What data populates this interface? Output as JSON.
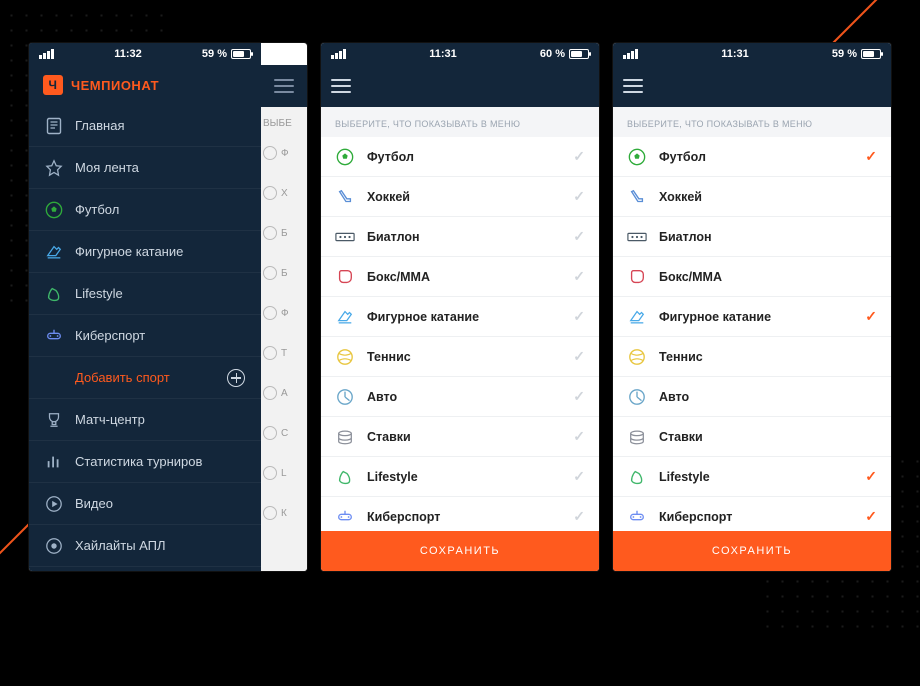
{
  "phones": [
    {
      "status": {
        "time": "11:32",
        "battery_label": "59 %",
        "battery_level": 0.59
      },
      "brand": "ЧЕМПИОНАТ",
      "menu": [
        {
          "icon": "news-icon",
          "label": "Главная"
        },
        {
          "icon": "star-icon",
          "label": "Моя лента"
        },
        {
          "icon": "football-icon",
          "label": "Футбол"
        },
        {
          "icon": "skating-icon",
          "label": "Фигурное катание"
        },
        {
          "icon": "lifestyle-icon",
          "label": "Lifestyle"
        },
        {
          "icon": "esports-icon",
          "label": "Киберспорт"
        },
        {
          "icon": "plus-icon",
          "label": "Добавить спорт",
          "accent": true,
          "plus": true
        },
        {
          "icon": "trophy-icon",
          "label": "Матч-центр"
        },
        {
          "icon": "stats-icon",
          "label": "Статистика турниров"
        },
        {
          "icon": "play-icon",
          "label": "Видео"
        },
        {
          "icon": "highlights-icon",
          "label": "Хайлайты АПЛ"
        }
      ],
      "under_hint": "ВЫБЕ",
      "under_items": [
        "Ф",
        "Х",
        "Б",
        "Б",
        "Ф",
        "Т",
        "А",
        "С",
        "L",
        "К"
      ]
    },
    {
      "status": {
        "time": "11:31",
        "battery_label": "60 %",
        "battery_level": 0.6
      },
      "section_title": "ВЫБЕРИТЕ, ЧТО ПОКАЗЫВАТЬ В МЕНЮ",
      "save_label": "СОХРАНИТЬ",
      "items": [
        {
          "icon": "football-icon",
          "label": "Футбол",
          "checked": "gray"
        },
        {
          "icon": "hockey-icon",
          "label": "Хоккей",
          "checked": "gray"
        },
        {
          "icon": "biathlon-icon",
          "label": "Биатлон",
          "checked": "gray"
        },
        {
          "icon": "boxing-icon",
          "label": "Бокс/ММА",
          "checked": "gray"
        },
        {
          "icon": "skating-icon",
          "label": "Фигурное катание",
          "checked": "gray"
        },
        {
          "icon": "tennis-icon",
          "label": "Теннис",
          "checked": "gray"
        },
        {
          "icon": "auto-icon",
          "label": "Авто",
          "checked": "gray"
        },
        {
          "icon": "betting-icon",
          "label": "Ставки",
          "checked": "gray"
        },
        {
          "icon": "lifestyle-icon",
          "label": "Lifestyle",
          "checked": "gray"
        },
        {
          "icon": "esports-icon",
          "label": "Киберспорт",
          "checked": "gray"
        }
      ]
    },
    {
      "status": {
        "time": "11:31",
        "battery_label": "59 %",
        "battery_level": 0.59
      },
      "section_title": "ВЫБЕРИТЕ, ЧТО ПОКАЗЫВАТЬ В МЕНЮ",
      "save_label": "СОХРАНИТЬ",
      "items": [
        {
          "icon": "football-icon",
          "label": "Футбол",
          "checked": "orange"
        },
        {
          "icon": "hockey-icon",
          "label": "Хоккей",
          "checked": "none"
        },
        {
          "icon": "biathlon-icon",
          "label": "Биатлон",
          "checked": "none"
        },
        {
          "icon": "boxing-icon",
          "label": "Бокс/ММА",
          "checked": "none"
        },
        {
          "icon": "skating-icon",
          "label": "Фигурное катание",
          "checked": "orange"
        },
        {
          "icon": "tennis-icon",
          "label": "Теннис",
          "checked": "none"
        },
        {
          "icon": "auto-icon",
          "label": "Авто",
          "checked": "none"
        },
        {
          "icon": "betting-icon",
          "label": "Ставки",
          "checked": "none"
        },
        {
          "icon": "lifestyle-icon",
          "label": "Lifestyle",
          "checked": "orange"
        },
        {
          "icon": "esports-icon",
          "label": "Киберспорт",
          "checked": "orange"
        }
      ]
    }
  ],
  "icon_colors": {
    "football-icon": "#2fab3a",
    "hockey-icon": "#5a8ed6",
    "biathlon-icon": "#4a5966",
    "boxing-icon": "#d64554",
    "skating-icon": "#49a9e8",
    "tennis-icon": "#e8c63f",
    "auto-icon": "#6aa6c9",
    "betting-icon": "#8b8f99",
    "lifestyle-icon": "#3fb76a",
    "esports-icon": "#6d8df2",
    "news-icon": "#9fb2c7",
    "star-icon": "#9fb2c7",
    "trophy-icon": "#9fb2c7",
    "stats-icon": "#9fb2c7",
    "play-icon": "#9fb2c7",
    "highlights-icon": "#9fb2c7"
  }
}
